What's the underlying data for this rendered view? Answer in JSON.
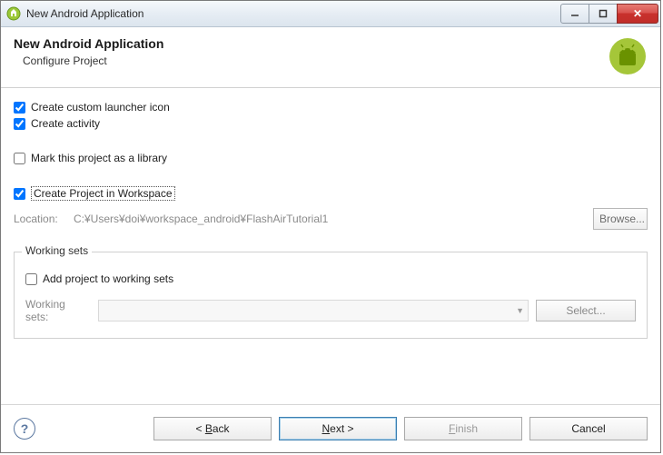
{
  "window": {
    "title": "New Android Application"
  },
  "banner": {
    "heading": "New Android Application",
    "subtitle": "Configure Project"
  },
  "options": {
    "create_launcher_icon": {
      "label": "Create custom launcher icon",
      "checked": true
    },
    "create_activity": {
      "label": "Create activity",
      "checked": true
    },
    "mark_library": {
      "label": "Mark this project as a library",
      "checked": false
    },
    "create_in_workspace": {
      "label": "Create Project in Workspace",
      "checked": true
    }
  },
  "location": {
    "label": "Location:",
    "value": "C:¥Users¥doi¥workspace_android¥FlashAirTutorial1",
    "browse": "Browse..."
  },
  "workingsets": {
    "legend": "Working sets",
    "add": {
      "label": "Add project to working sets",
      "checked": false
    },
    "combo_label": "Working sets:",
    "select": "Select..."
  },
  "footer": {
    "back": "< Back",
    "next": "Next >",
    "finish": "Finish",
    "cancel": "Cancel"
  }
}
